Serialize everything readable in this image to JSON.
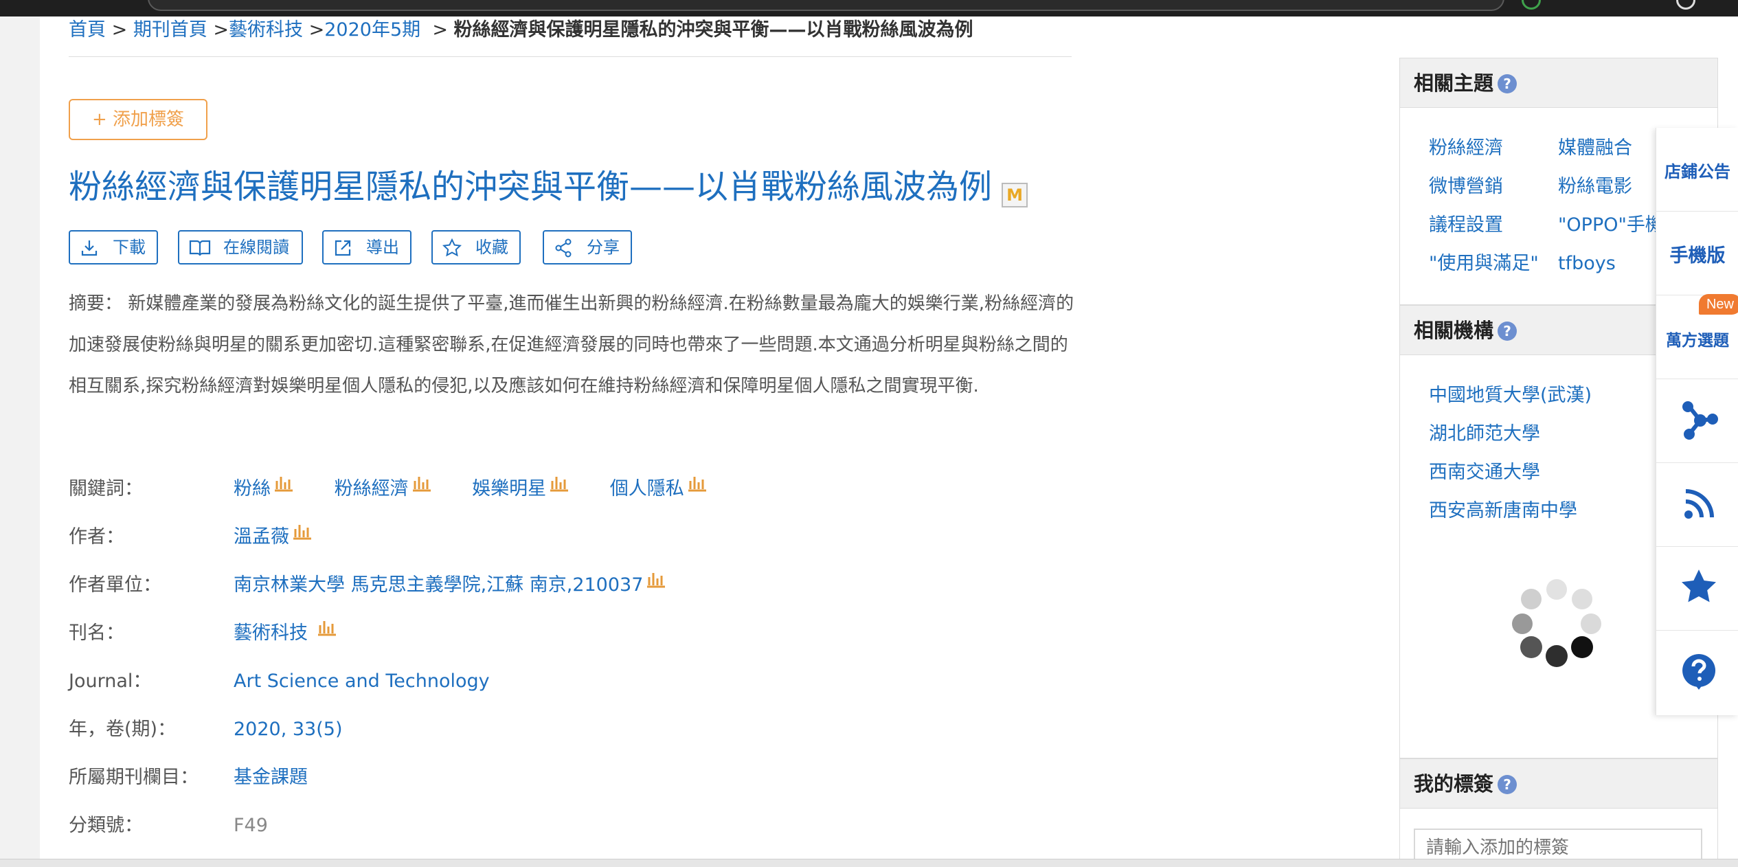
{
  "breadcrumb": {
    "home": "首頁",
    "sep": ">",
    "journals_home": "期刊首頁",
    "journal": "藝術科技",
    "issue": "2020年5期",
    "current": "粉絲經濟與保護明星隱私的沖突與平衡——以肖戰粉絲風波為例"
  },
  "add_tag_label": "+ 添加標簽",
  "article": {
    "title": "粉絲經濟與保護明星隱私的沖突與平衡——以肖戰粉絲風波為例",
    "m_badge": "M"
  },
  "actions": {
    "download": "下載",
    "read_online": "在線閱讀",
    "export": "導出",
    "favorite": "收藏",
    "share": "分享"
  },
  "abstract": {
    "label": "摘要：",
    "text": "新媒體產業的發展為粉絲文化的誕生提供了平臺,進而催生出新興的粉絲經濟.在粉絲數量最為龐大的娛樂行業,粉絲經濟的加速發展使粉絲與明星的關系更加密切.這種緊密聯系,在促進經濟發展的同時也帶來了一些問題.本文通過分析明星與粉絲之間的相互關系,探究粉絲經濟對娛樂明星個人隱私的侵犯,以及應該如何在維持粉絲經濟和保障明星個人隱私之間實現平衡."
  },
  "meta": {
    "keywords_label": "關鍵詞：",
    "keywords": [
      "粉絲",
      "粉絲經濟",
      "娛樂明星",
      "個人隱私"
    ],
    "author_label": "作者：",
    "author": "溫孟薇",
    "affiliation_label": "作者單位：",
    "affiliation": "南京林業大學 馬克思主義學院,江蘇 南京,210037",
    "journal_label": "刊名：",
    "journal": "藝術科技",
    "journal_en_label": "Journal：",
    "journal_en": "Art Science and Technology",
    "year_label": "年，卷(期)：",
    "year": "2020, 33(5)",
    "column_label": "所屬期刊欄目：",
    "column": "基金課題",
    "class_label": "分類號：",
    "class_no": "F49"
  },
  "sidebar": {
    "topics_title": "相關主題",
    "topics": [
      "粉絲經濟",
      "媒體融合",
      "微博營銷",
      "粉絲電影",
      "議程設置",
      "\"OPPO\"手機",
      "\"使用與滿足\"",
      "tfboys"
    ],
    "orgs_title": "相關機構",
    "orgs": [
      "中國地質大學(武漢)",
      "湖北師范大學",
      "西南交通大學",
      "西安高新唐南中學"
    ],
    "my_tags_title": "我的標簽",
    "tag_placeholder": "請輸入添加的標簽",
    "help_glyph": "?"
  },
  "float_bar": {
    "store_notice": "店鋪公告",
    "mobile": "手機版",
    "topic_select": "萬方選題",
    "new_badge": "New"
  },
  "colors": {
    "link": "#1e6fbf",
    "accent_orange": "#f0a04b",
    "float_blue": "#1e5eb8"
  }
}
